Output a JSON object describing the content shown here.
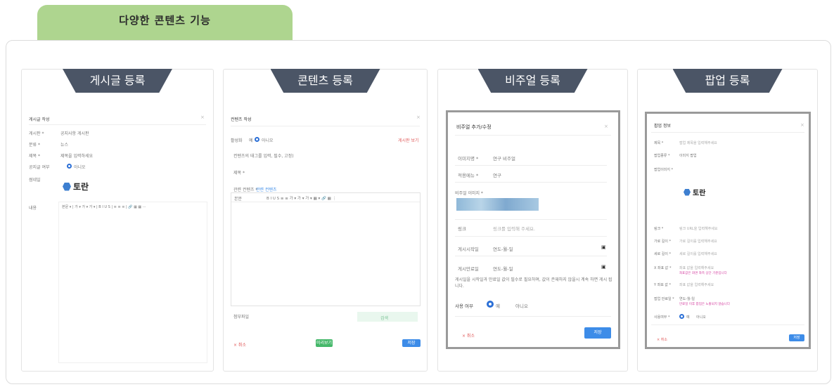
{
  "header": {
    "tab_label": "다양한 콘텐츠 기능"
  },
  "cards": {
    "post": {
      "title": "게시글 등록",
      "form_title": "게시글 작성",
      "rows": [
        "게시판 *",
        "분류 *",
        "제목 *",
        "공지글 여부",
        "썸네일"
      ],
      "row_values": [
        "공지사항 게시판",
        "뉴스",
        "제목을 입력하세요",
        "아니오"
      ],
      "logo_text": "토란",
      "content_label": "내용",
      "editor_toolbar": "본문 ▾ | 가 ▾ 가 ▾ 가 ▾ | B I U S | ≡ ≡ ≡ | 🔗 ▦ ▦ ⋯"
    },
    "content": {
      "title": "콘텐츠 등록",
      "form_title": "컨텐츠 작성",
      "status_label": "활성화",
      "status_yes": "예",
      "status_no": "아니오",
      "top_link": "게시판 보기",
      "desc": "컨텐츠의 태그를 입력, 필수, 고정)",
      "name_label": "제목 *",
      "related_label": "관련 컨텐츠 *",
      "related_link": "관련 컨텐츠",
      "editor_mode": "본문",
      "editor_toolbar": "B I U S ≡ ≡ 가 ▾ 가 ▾ 가 ▾ ▦ ▾ 🔗 ▦ ⋮",
      "attach_label": "첨부파일",
      "search_label": "검색",
      "cancel_label": "× 취소",
      "preview_label": "미리보기",
      "save_label": "저장"
    },
    "visual": {
      "title": "비주얼 등록",
      "modal_title": "비주얼 추가/수정",
      "fields": [
        {
          "label": "이미지명 *",
          "value": "연구 비주얼"
        },
        {
          "label": "적용메뉴 *",
          "value": "연구"
        },
        {
          "label": "비주얼 이미지 *",
          "value": ""
        },
        {
          "label": "링크",
          "value": "링크를 입력해 주세요."
        },
        {
          "label": "게시시작일",
          "value": "연도-월-일"
        },
        {
          "label": "게시만료일",
          "value": "연도-월-일"
        }
      ],
      "note": "게시일을 시작일과 만료일 값이 필수로 필요하며, 값이 존재하지 않을시 계속 하면 게시 됩니다.",
      "use_label": "사용 여부",
      "use_yes": "예",
      "use_no": "아니오",
      "cancel_label": "× 취소",
      "save_label": "저장"
    },
    "popup": {
      "title": "팝업 등록",
      "form_title": "팝업 정보",
      "rows": [
        "제목 *",
        "팝업종류 *",
        "팝업이미지 *",
        "링크 *",
        "가로 길이 *",
        "세로 길이 *",
        "X 좌표 값 *",
        "Y 좌표 값 *",
        "팝업 만료일 *",
        "사용여부 *"
      ],
      "row_values": [
        "팝업 제목을 입력해주세요",
        "이미지 팝업",
        "",
        "링크 URL을 입력해주세요",
        "가로 길이를 입력해주세요",
        "세로 길이를 입력해주세요",
        "좌표 값을 입력해주세요",
        "좌표 값을 입력해주세요",
        "연도-월-일",
        "예"
      ],
      "pink_note_1": "좌표값은 화면 좌측 상단 기준입니다",
      "pink_note_2": "만료일 이후 팝업은 노출되지 않습니다",
      "use_no": "아니오",
      "logo_text": "토란",
      "cancel_label": "× 취소",
      "save_label": "저장"
    }
  },
  "colors": {
    "tab_bg": "#aed58f",
    "banner_bg": "#4b5566",
    "accent_blue": "#3d8ce8",
    "accent_green": "#45b86a",
    "pink": "#d43fa0"
  }
}
